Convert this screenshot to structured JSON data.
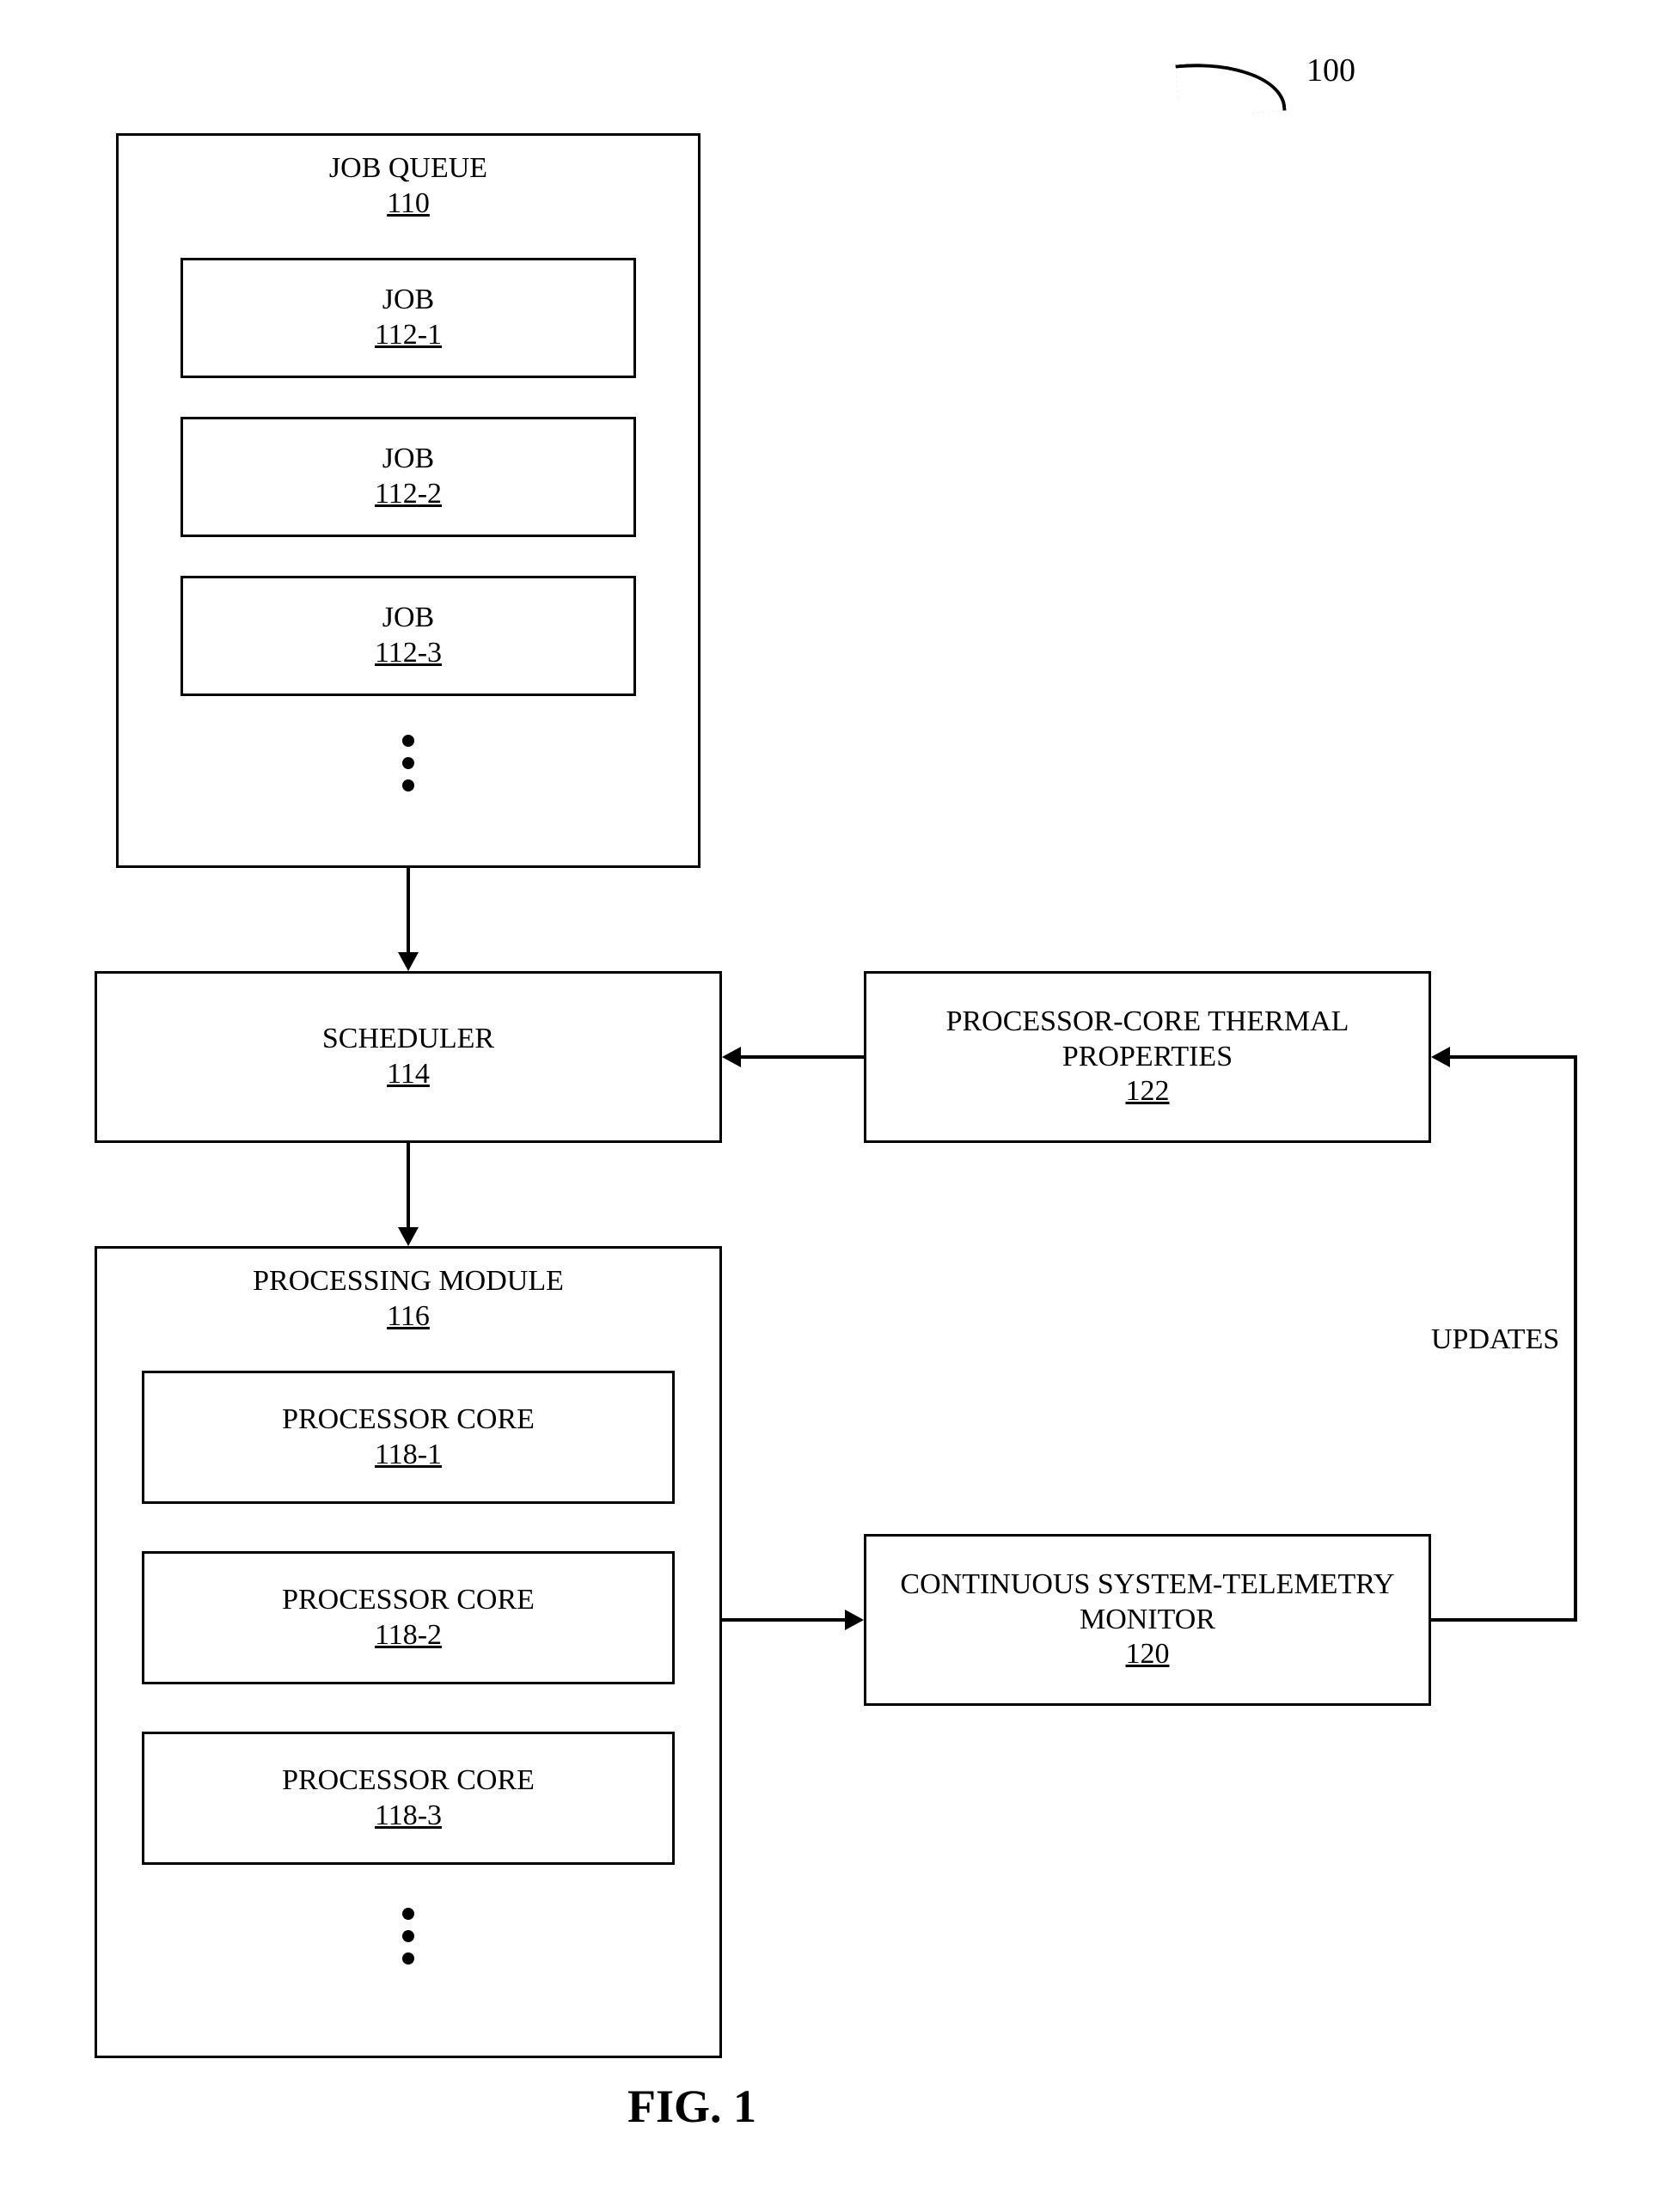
{
  "figure": {
    "id": "100",
    "caption": "FIG. 1"
  },
  "blocks": {
    "job_queue": {
      "title": "JOB QUEUE",
      "ref": "110"
    },
    "job1": {
      "title": "JOB",
      "ref": "112-1"
    },
    "job2": {
      "title": "JOB",
      "ref": "112-2"
    },
    "job3": {
      "title": "JOB",
      "ref": "112-3"
    },
    "scheduler": {
      "title": "SCHEDULER",
      "ref": "114"
    },
    "processing_module": {
      "title": "PROCESSING MODULE",
      "ref": "116"
    },
    "core1": {
      "title": "PROCESSOR CORE",
      "ref": "118-1"
    },
    "core2": {
      "title": "PROCESSOR CORE",
      "ref": "118-2"
    },
    "core3": {
      "title": "PROCESSOR CORE",
      "ref": "118-3"
    },
    "telemetry": {
      "title": "CONTINUOUS SYSTEM-TELEMETRY MONITOR",
      "ref": "120"
    },
    "thermal": {
      "title": "PROCESSOR-CORE THERMAL PROPERTIES",
      "ref": "122"
    }
  },
  "edges": {
    "updates_label": "UPDATES"
  }
}
